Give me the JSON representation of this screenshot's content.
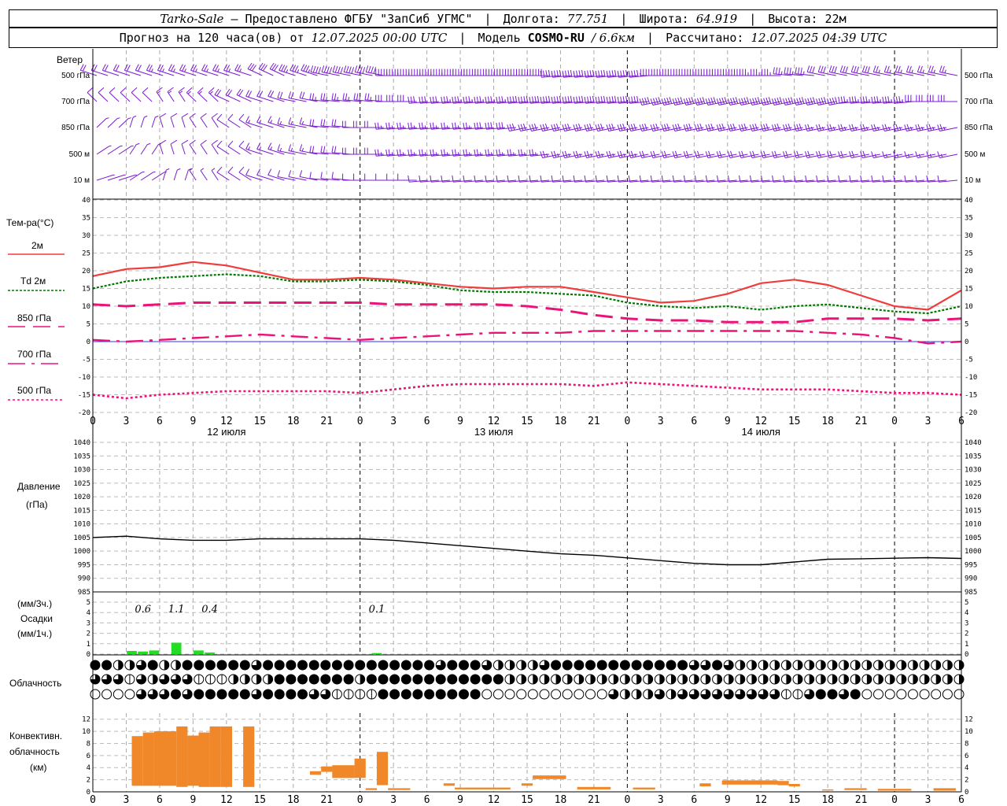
{
  "header": {
    "station": "Tarko-Sale",
    "dash": "–",
    "provider": "Предоставлено ФГБУ \"ЗапСиб УГМС\"",
    "lon_label": "Долгота:",
    "lon_value": "77.751",
    "lat_label": "Широта:",
    "lat_value": "64.919",
    "alt_label": "Высота:",
    "alt_value": "22м",
    "forecast_prefix": "Прогноз на 120 часа(ов) от",
    "forecast_start": "12.07.2025 00:00 UTC",
    "model_label": "Модель",
    "model_name": "COSMO-RU",
    "model_res": "/ 6.6км",
    "calc_label": "Рассчитано:",
    "calc_time": "12.07.2025 04:39 UTC"
  },
  "labels": {
    "wind_title": "Ветер",
    "wind_levels": [
      "500 гПа",
      "700 гПа",
      "850 гПа",
      "500 м",
      "10  м"
    ],
    "temp_title": "Тем-ра(°С)",
    "legend": [
      "2м",
      "Td  2м",
      "850 гПа",
      "700 гПа",
      "500 гПа"
    ],
    "pressure_title": "Давление",
    "pressure_unit": "(гПа)",
    "precip_unit_top": "(мм/3ч.)",
    "precip_title": "Осадки",
    "precip_unit": "(мм/1ч.)",
    "cloud_title": "Облачность",
    "conv_title": "Конвективн.",
    "conv_title2": "облачность",
    "conv_unit": "(км)"
  },
  "colors": {
    "t2m": "#f03c3c",
    "td2m": "#007a00",
    "t850": "#e8147a",
    "t700": "#e8147a",
    "t500": "#e8147a",
    "wind": "#7a1ad0",
    "precip": "#22dd22",
    "conv": "#f0882a",
    "zero_line": "#3030ff"
  },
  "chart_data": {
    "type": "line",
    "x_hours": [
      0,
      3,
      6,
      9,
      12,
      15,
      18,
      21,
      24,
      27,
      30,
      33,
      36,
      39,
      42,
      45,
      48,
      51,
      54,
      57,
      60,
      63,
      66,
      69,
      72,
      75,
      78
    ],
    "x_tick_labels": [
      "0",
      "3",
      "6",
      "9",
      "12",
      "15",
      "18",
      "21",
      "0",
      "3",
      "6",
      "9",
      "12",
      "15",
      "18",
      "21",
      "0",
      "3",
      "6",
      "9",
      "12",
      "15",
      "18",
      "21",
      "0",
      "3",
      "6"
    ],
    "day_labels": [
      "12 июля",
      "13 июля",
      "14 июля"
    ],
    "temperature": {
      "ylim": [
        -20,
        40
      ],
      "ticks": [
        40,
        35,
        30,
        25,
        20,
        15,
        10,
        5,
        0,
        -5,
        -10,
        -15,
        -20
      ],
      "series": [
        {
          "name": "2м",
          "x": [
            0,
            3,
            6,
            8,
            9,
            12,
            15,
            18,
            21,
            24,
            27,
            30,
            33,
            36,
            39,
            42,
            45,
            48,
            51,
            54,
            57,
            60,
            63,
            66,
            69,
            72,
            75,
            78
          ],
          "y": [
            18.5,
            20.5,
            21,
            22,
            22.5,
            21.5,
            19.5,
            17.5,
            17.5,
            18,
            17.5,
            16.5,
            15.5,
            15,
            15.5,
            15.5,
            14,
            12.5,
            11,
            11.5,
            13.5,
            16.5,
            17.5,
            16,
            13,
            10,
            9,
            14.5
          ]
        },
        {
          "name": "Td  2м",
          "x": [
            0,
            3,
            6,
            9,
            12,
            15,
            18,
            21,
            24,
            27,
            30,
            33,
            36,
            39,
            42,
            45,
            48,
            51,
            54,
            57,
            60,
            63,
            66,
            69,
            72,
            75,
            78
          ],
          "y": [
            15,
            17,
            18,
            18.5,
            19,
            18.5,
            17,
            17,
            17.5,
            17,
            16,
            14.5,
            14,
            14,
            13.5,
            13,
            11,
            10,
            9.5,
            10,
            9,
            10,
            10.5,
            9.5,
            8.5,
            8,
            10
          ]
        },
        {
          "name": "850 гПа",
          "x": [
            0,
            3,
            6,
            9,
            12,
            15,
            18,
            21,
            24,
            27,
            30,
            33,
            36,
            39,
            42,
            45,
            48,
            51,
            54,
            57,
            60,
            63,
            66,
            69,
            72,
            75,
            78
          ],
          "y": [
            10.5,
            10,
            10.5,
            11,
            11,
            11,
            11,
            11,
            11,
            10.5,
            10.5,
            10.5,
            10.5,
            10,
            9,
            7.5,
            6.5,
            6,
            6,
            5.5,
            5.5,
            5.5,
            6.5,
            6.5,
            6.5,
            6,
            6.5
          ]
        },
        {
          "name": "700 гПа",
          "x": [
            0,
            3,
            6,
            9,
            12,
            15,
            18,
            21,
            24,
            27,
            30,
            33,
            36,
            39,
            42,
            45,
            48,
            51,
            54,
            57,
            60,
            63,
            66,
            69,
            72,
            75,
            78
          ],
          "y": [
            0.5,
            0,
            0.5,
            1,
            1.5,
            2,
            1.5,
            1,
            0.5,
            1,
            1.5,
            2,
            2.5,
            2.5,
            2.5,
            3,
            3,
            3,
            3,
            3,
            3,
            3,
            2.5,
            2,
            1,
            -0.5,
            0
          ]
        },
        {
          "name": "500 гПа",
          "x": [
            0,
            3,
            6,
            9,
            12,
            15,
            18,
            21,
            24,
            27,
            30,
            33,
            36,
            39,
            42,
            45,
            48,
            51,
            54,
            57,
            60,
            63,
            66,
            69,
            72,
            75,
            78
          ],
          "y": [
            -15,
            -16,
            -15,
            -14.5,
            -14,
            -14,
            -14,
            -14,
            -14.5,
            -13.5,
            -12.5,
            -12,
            -12,
            -12,
            -12,
            -12.5,
            -11.5,
            -12,
            -12.5,
            -13,
            -13.5,
            -13.5,
            -13.5,
            -14,
            -14.5,
            -14.5,
            -15
          ]
        }
      ]
    },
    "pressure": {
      "ylim": [
        985,
        1040
      ],
      "ticks": [
        1040,
        1035,
        1030,
        1025,
        1020,
        1015,
        1010,
        1005,
        1000,
        995,
        990,
        985
      ],
      "series": [
        {
          "name": "Давление",
          "x": [
            0,
            3,
            6,
            9,
            12,
            15,
            18,
            21,
            24,
            27,
            30,
            33,
            36,
            39,
            42,
            45,
            48,
            51,
            54,
            57,
            60,
            63,
            66,
            69,
            72,
            75,
            78
          ],
          "y": [
            1005,
            1005.5,
            1004.5,
            1004,
            1004,
            1004.5,
            1004.5,
            1004.5,
            1004.5,
            1004,
            1003,
            1002,
            1001,
            1000,
            999,
            998.5,
            997.5,
            996.5,
            995.5,
            995,
            995,
            996,
            997,
            997.2,
            997.4,
            997.6,
            997.3
          ]
        }
      ]
    },
    "precipitation": {
      "ylim": [
        0,
        5
      ],
      "ticks": [
        5,
        4,
        3,
        2,
        1,
        0
      ],
      "hourly": [
        {
          "x": 3.5,
          "v": 0.3
        },
        {
          "x": 4.5,
          "v": 0.25
        },
        {
          "x": 5.5,
          "v": 0.35
        },
        {
          "x": 7.5,
          "v": 1.1
        },
        {
          "x": 9.5,
          "v": 0.35
        },
        {
          "x": 10.5,
          "v": 0.15
        },
        {
          "x": 25.5,
          "v": 0.1
        }
      ],
      "three_hour_labels": [
        {
          "x": 4.5,
          "text": "0.6"
        },
        {
          "x": 7.5,
          "text": "1.1"
        },
        {
          "x": 10.5,
          "text": "0.4"
        },
        {
          "x": 25.5,
          "text": "0.1"
        }
      ]
    },
    "cloud_cover": {
      "rows": [
        "4422342244444434444444444444443444322223444444444444334322222222222222222222",
        "3331323331112222444444424444444444442222222222222222222222222222222222222222",
        "0000333434444434444331111444444444000000000003222323333333331134434000000000"
      ]
    },
    "convective": {
      "ylim": [
        0,
        13
      ],
      "ticks": [
        12,
        10,
        8,
        6,
        4,
        2,
        0
      ],
      "bars": [
        {
          "x0": 3.5,
          "x1": 4.5,
          "b": 1,
          "t": 9.2
        },
        {
          "x0": 4.5,
          "x1": 5.5,
          "b": 1,
          "t": 9.8
        },
        {
          "x0": 5.5,
          "x1": 6.5,
          "b": 1,
          "t": 10
        },
        {
          "x0": 6.5,
          "x1": 7.5,
          "b": 1,
          "t": 10
        },
        {
          "x0": 7.5,
          "x1": 8.5,
          "b": 0.8,
          "t": 10.8
        },
        {
          "x0": 8.5,
          "x1": 9.5,
          "b": 1,
          "t": 9.3
        },
        {
          "x0": 9.5,
          "x1": 10.5,
          "b": 0.8,
          "t": 9.8
        },
        {
          "x0": 10.5,
          "x1": 11.5,
          "b": 0.8,
          "t": 10.8
        },
        {
          "x0": 11.5,
          "x1": 12.5,
          "b": 0.8,
          "t": 10.8
        },
        {
          "x0": 13.5,
          "x1": 14.5,
          "b": 0.8,
          "t": 10.8
        },
        {
          "x0": 19.5,
          "x1": 20.5,
          "b": 2.8,
          "t": 3.4
        },
        {
          "x0": 20.5,
          "x1": 21.5,
          "b": 3.3,
          "t": 4.2
        },
        {
          "x0": 21.5,
          "x1": 22.5,
          "b": 2.3,
          "t": 4.4
        },
        {
          "x0": 22.5,
          "x1": 23.5,
          "b": 2.3,
          "t": 4.4
        },
        {
          "x0": 23.5,
          "x1": 24.5,
          "b": 2.3,
          "t": 5.5
        },
        {
          "x0": 24.5,
          "x1": 25.5,
          "b": 0.3,
          "t": 0.6
        },
        {
          "x0": 25.5,
          "x1": 26.5,
          "b": 1.1,
          "t": 6.6
        },
        {
          "x0": 26.5,
          "x1": 28.5,
          "b": 0.3,
          "t": 0.6
        },
        {
          "x0": 31.5,
          "x1": 32.5,
          "b": 1,
          "t": 1.4
        },
        {
          "x0": 32.5,
          "x1": 37.5,
          "b": 0.4,
          "t": 0.7
        },
        {
          "x0": 38.5,
          "x1": 39.5,
          "b": 1,
          "t": 1.4
        },
        {
          "x0": 39.5,
          "x1": 40.5,
          "b": 2.1,
          "t": 2.7
        },
        {
          "x0": 40.5,
          "x1": 42.5,
          "b": 2.1,
          "t": 2.7
        },
        {
          "x0": 43.5,
          "x1": 46.5,
          "b": 0.4,
          "t": 0.8
        },
        {
          "x0": 48.5,
          "x1": 50.5,
          "b": 0.4,
          "t": 0.7
        },
        {
          "x0": 54.5,
          "x1": 55.5,
          "b": 0.9,
          "t": 1.4
        },
        {
          "x0": 56.5,
          "x1": 61.5,
          "b": 1.2,
          "t": 1.9
        },
        {
          "x0": 61.5,
          "x1": 62.5,
          "b": 1.1,
          "t": 1.8
        },
        {
          "x0": 62.5,
          "x1": 63.5,
          "b": 0.9,
          "t": 1.3
        },
        {
          "x0": 65.5,
          "x1": 66.5,
          "b": 0.2,
          "t": 0.4
        },
        {
          "x0": 67.5,
          "x1": 69.5,
          "b": 0.3,
          "t": 0.6
        },
        {
          "x0": 70.5,
          "x1": 73.5,
          "b": 0.2,
          "t": 0.5
        },
        {
          "x0": 75.5,
          "x1": 77.5,
          "b": 0.2,
          "t": 0.6
        }
      ]
    },
    "wind_barbs": {
      "levels": [
        "500 гПа",
        "700 гПа",
        "850 гПа",
        "500 м",
        "10  м"
      ],
      "note_units": "knots",
      "dir_deg": [
        [
          300,
          300,
          300,
          300,
          300,
          310,
          300,
          290,
          290,
          270,
          270,
          270,
          270,
          270,
          260,
          260,
          260,
          270,
          270,
          270,
          270,
          280,
          290,
          290,
          290,
          290,
          290
        ],
        [
          330,
          330,
          340,
          330,
          310,
          300,
          290,
          280,
          280,
          270,
          260,
          260,
          260,
          260,
          260,
          260,
          260,
          250,
          250,
          250,
          250,
          250,
          250,
          260,
          260,
          270,
          270
        ],
        [
          30,
          10,
          350,
          340,
          320,
          300,
          290,
          280,
          270,
          260,
          260,
          260,
          260,
          250,
          250,
          250,
          250,
          250,
          250,
          250,
          250,
          250,
          250,
          250,
          250,
          250,
          250
        ],
        [
          40,
          20,
          350,
          340,
          320,
          300,
          290,
          280,
          270,
          260,
          260,
          260,
          260,
          260,
          250,
          250,
          250,
          250,
          250,
          250,
          250,
          250,
          250,
          250,
          250,
          250,
          250
        ],
        [
          60,
          40,
          10,
          340,
          320,
          300,
          290,
          280,
          270,
          270,
          260,
          260,
          260,
          260,
          260,
          260,
          260,
          260,
          260,
          260,
          260,
          260,
          260,
          260,
          260,
          260,
          260
        ]
      ],
      "speed_kt": [
        [
          20,
          20,
          25,
          25,
          25,
          30,
          35,
          40,
          40,
          45,
          45,
          50,
          50,
          50,
          45,
          45,
          45,
          40,
          40,
          40,
          35,
          35,
          30,
          30,
          25,
          25,
          25
        ],
        [
          10,
          10,
          15,
          15,
          20,
          20,
          20,
          25,
          25,
          30,
          30,
          35,
          35,
          40,
          40,
          40,
          40,
          40,
          40,
          40,
          40,
          40,
          40,
          35,
          35,
          30,
          30
        ],
        [
          5,
          5,
          10,
          10,
          10,
          15,
          15,
          20,
          20,
          25,
          25,
          25,
          30,
          30,
          30,
          30,
          30,
          30,
          30,
          30,
          30,
          30,
          25,
          25,
          25,
          25,
          25
        ],
        [
          5,
          5,
          10,
          10,
          10,
          15,
          15,
          20,
          20,
          25,
          25,
          25,
          25,
          25,
          25,
          25,
          25,
          20,
          20,
          20,
          20,
          20,
          20,
          20,
          15,
          15,
          15
        ],
        [
          5,
          5,
          5,
          5,
          10,
          10,
          10,
          10,
          10,
          10,
          10,
          10,
          10,
          10,
          10,
          10,
          10,
          10,
          10,
          10,
          10,
          10,
          10,
          10,
          10,
          10,
          10
        ]
      ]
    }
  }
}
